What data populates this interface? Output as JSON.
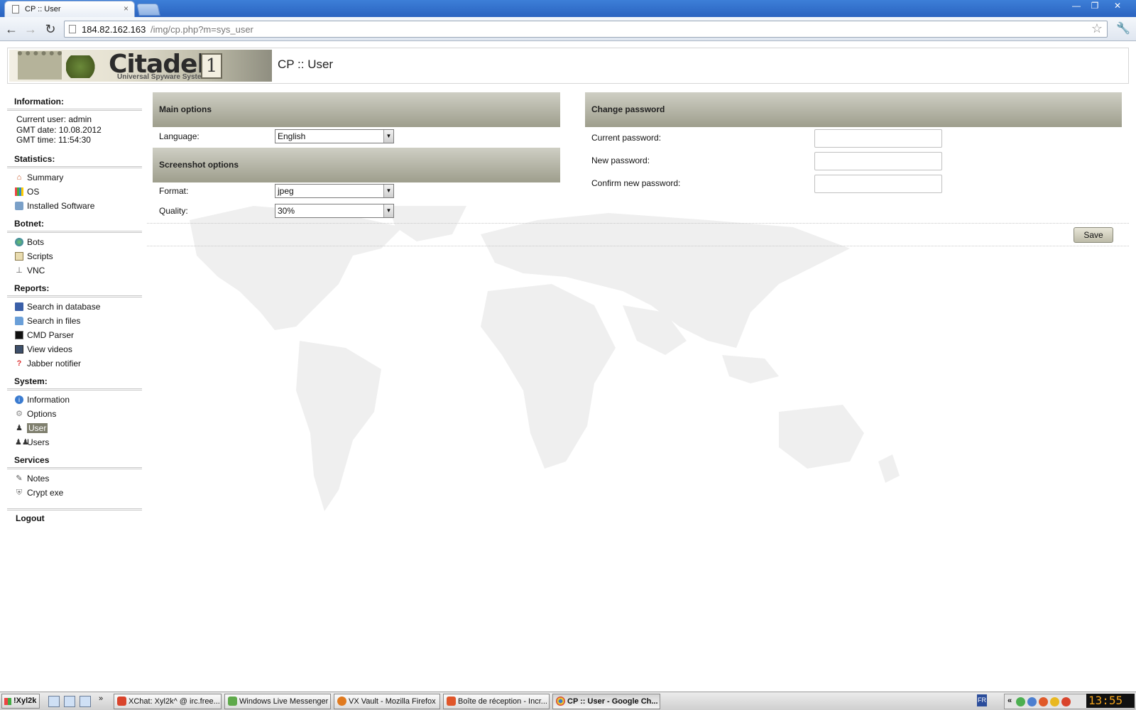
{
  "browser": {
    "tab_title": "CP :: User",
    "tab_close": "×",
    "url_host": "184.82.162.163",
    "url_path": "/img/cp.php?m=sys_user",
    "back": "←",
    "forward": "→",
    "reload": "↻",
    "star": "☆",
    "wrench": "🔧",
    "win_min": "—",
    "win_restore": "❐",
    "win_close": "✕"
  },
  "header": {
    "logo_text": "Citadel",
    "logo_subtitle": "Universal Spyware System",
    "logo_badge": "1",
    "page_title": "CP :: User"
  },
  "sidebar": {
    "information": {
      "heading": "Information:",
      "current_user": "Current user: admin",
      "gmt_date": "GMT date: 10.08.2012",
      "gmt_time": "GMT time: 11:54:30"
    },
    "statistics": {
      "heading": "Statistics:",
      "items": [
        "Summary",
        "OS",
        "Installed Software"
      ]
    },
    "botnet": {
      "heading": "Botnet:",
      "items": [
        "Bots",
        "Scripts",
        "VNC"
      ]
    },
    "reports": {
      "heading": "Reports:",
      "items": [
        "Search in database",
        "Search in files",
        "CMD Parser",
        "View videos",
        "Jabber notifier"
      ]
    },
    "system": {
      "heading": "System:",
      "items": [
        "Information",
        "Options",
        "User",
        "Users"
      ],
      "active": "User"
    },
    "services": {
      "heading": "Services",
      "items": [
        "Notes",
        "Crypt exe"
      ]
    },
    "logout": "Logout"
  },
  "main_options": {
    "title": "Main options",
    "language_label": "Language:",
    "language_value": "English"
  },
  "screenshot_options": {
    "title": "Screenshot options",
    "format_label": "Format:",
    "format_value": "jpeg",
    "quality_label": "Quality:",
    "quality_value": "30%"
  },
  "change_password": {
    "title": "Change password",
    "current_label": "Current password:",
    "new_label": "New password:",
    "confirm_label": "Confirm new password:",
    "current_value": "",
    "new_value": "",
    "confirm_value": ""
  },
  "save_label": "Save",
  "taskbar": {
    "start_label": "!Xyl2k",
    "more": "»",
    "tasks": [
      "XChat: Xyl2k^ @ irc.free...",
      "Windows Live Messenger",
      "VX Vault - Mozilla Firefox",
      "Boîte de réception - Incr...",
      "CP :: User - Google Ch..."
    ],
    "language_indicator": "FR",
    "tray_chevron": "«",
    "clock": "13:55"
  },
  "colors": {
    "panel_header": "#a9a998",
    "active_item": "#7f7f6e",
    "titlebar": "#2f6dcb"
  }
}
